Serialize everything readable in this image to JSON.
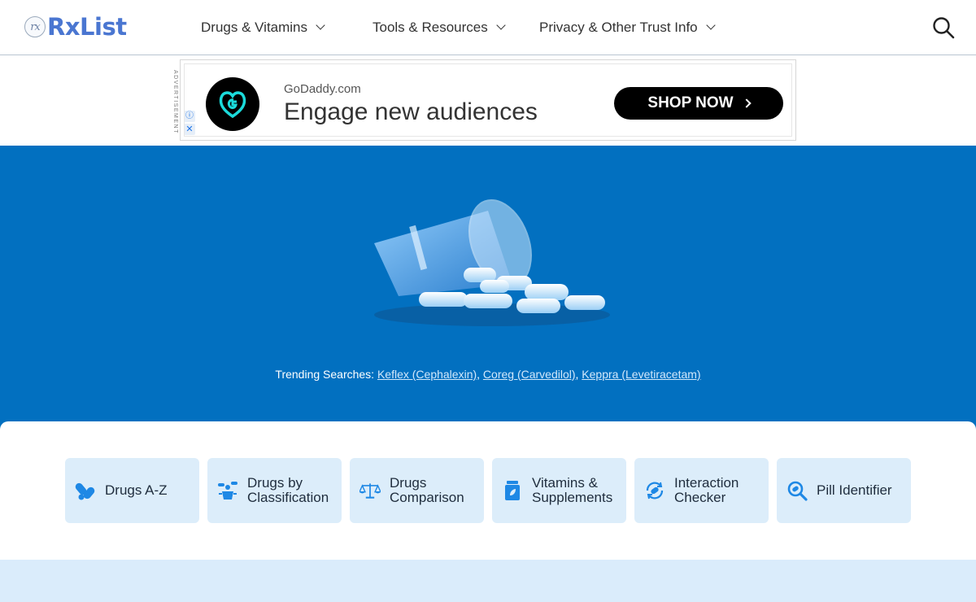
{
  "header": {
    "logo_mark": "rx",
    "logo_text": "RxList",
    "nav": [
      {
        "label": "Drugs & Vitamins"
      },
      {
        "label": "Tools & Resources"
      },
      {
        "label": "Privacy & Other Trust Info"
      }
    ],
    "search_icon": "search-icon"
  },
  "ad": {
    "tag": "ADVERTISEMENT",
    "info_icon": "ⓘ",
    "close_icon": "✕",
    "brand": "GoDaddy.com",
    "headline": "Engage new audiences",
    "cta": "SHOP NOW"
  },
  "hero": {
    "trending_label": "Trending Searches:",
    "trending": [
      {
        "label": "Keflex (Cephalexin)"
      },
      {
        "label": "Coreg (Carvedilol)"
      },
      {
        "label": "Keppra (Levetiracetam)"
      }
    ]
  },
  "quick_links": [
    {
      "label_1": "Drugs A-Z",
      "label_2": "",
      "icon": "pills-icon"
    },
    {
      "label_1": "Drugs by",
      "label_2": "Classification",
      "icon": "classification-icon"
    },
    {
      "label_1": "Drugs",
      "label_2": "Comparison",
      "icon": "scale-icon"
    },
    {
      "label_1": "Vitamins &",
      "label_2": "Supplements",
      "icon": "supplement-bottle-icon"
    },
    {
      "label_1": "Interaction",
      "label_2": "Checker",
      "icon": "interaction-icon"
    },
    {
      "label_1": "Pill Identifier",
      "label_2": "",
      "icon": "pill-search-icon"
    }
  ],
  "colors": {
    "brand_blue": "#4a76d1",
    "hero_blue": "#0270c0",
    "tile_bg": "#dcedfa",
    "icon_blue": "#1e88e5"
  }
}
